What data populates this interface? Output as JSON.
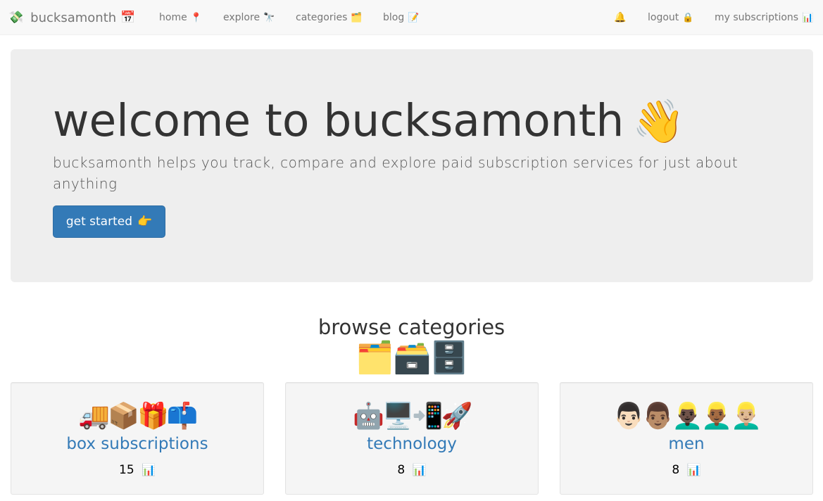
{
  "navbar": {
    "brand_icon": "💸",
    "brand": "bucksamonth",
    "brand_suffix": "📅",
    "links": [
      {
        "label": "home",
        "emoji": "📍"
      },
      {
        "label": "explore",
        "emoji": "🔭"
      },
      {
        "label": "categories",
        "emoji": "🗂️"
      },
      {
        "label": "blog",
        "emoji": "📝"
      }
    ],
    "bell_icon": "🔔",
    "logout": {
      "label": "logout",
      "emoji": "🔒"
    },
    "subscriptions": {
      "label": "my subscriptions",
      "emoji": "📊"
    }
  },
  "hero": {
    "title": "welcome to bucksamonth",
    "title_emoji": "👋",
    "lead": "bucksamonth helps you track, compare and explore paid subscription services for just about anything",
    "button_label": "get started",
    "button_emoji": "👉"
  },
  "browse": {
    "title": "browse categories",
    "icons": "🗂️🗃️🗄️"
  },
  "categories": [
    {
      "icons": "🚚📦🎁📫",
      "title": "box subscriptions",
      "count": "15",
      "count_emoji": "📊"
    },
    {
      "icons": "🤖🖥️📲🚀",
      "title": "technology",
      "count": "8",
      "count_emoji": "📊"
    },
    {
      "icons": "👨🏻👨🏽👱🏿‍♂️👱🏾‍♂️👱🏼‍♂️",
      "title": "men",
      "count": "8",
      "count_emoji": "📊"
    }
  ],
  "colors": {
    "primary": "#337ab7",
    "navbar_bg": "#f8f8f8",
    "jumbotron_bg": "#eeeeee",
    "card_bg": "#f5f5f5"
  }
}
